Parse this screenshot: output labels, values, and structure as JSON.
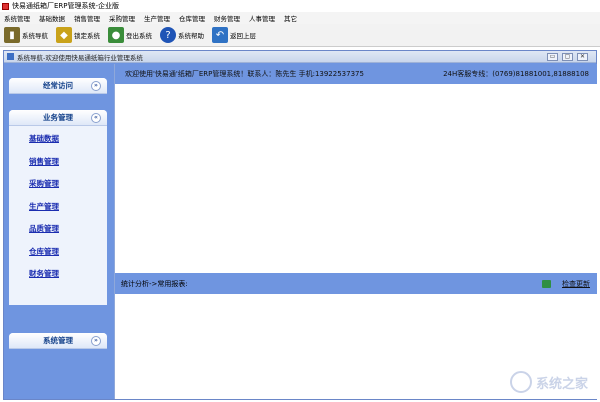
{
  "window": {
    "title": "快易通纸箱厂ERP管理系统-企业版"
  },
  "menu": [
    "系统管理",
    "基础数据",
    "销售管理",
    "采购管理",
    "生产管理",
    "仓库管理",
    "财务管理",
    "人事管理",
    "其它"
  ],
  "toolbar": [
    {
      "label": "系统导航",
      "icon": "book-icon",
      "color": "#7a6a2a"
    },
    {
      "label": "锁定系统",
      "icon": "lock-icon",
      "color": "#c9a21a"
    },
    {
      "label": "登出系统",
      "icon": "users-icon",
      "color": "#3a8d3a"
    },
    {
      "label": "系统帮助",
      "icon": "help-icon",
      "color": "#1f54b6"
    },
    {
      "label": "返回上层",
      "icon": "back-arrow-icon",
      "color": "#2f72c4"
    }
  ],
  "inner_window": {
    "title": "系统导航-欢迎使用快易通纸箱行业管理系统",
    "buttons": [
      "▭",
      "▢",
      "✕"
    ]
  },
  "sidebar": {
    "panels": [
      {
        "title": "经常访问",
        "expanded": false
      },
      {
        "title": "业务管理",
        "expanded": true,
        "items": [
          "基础数据",
          "销售管理",
          "采购管理",
          "生产管理",
          "品质管理",
          "仓库管理",
          "财务管理"
        ]
      },
      {
        "title": "系统管理",
        "expanded": false
      }
    ]
  },
  "welcome": {
    "text": "欢迎使用'快易通'纸箱厂ERP管理系统！联系人：陈先生 手机:13922537375",
    "hotline": "24H客服专线：(0769)81881001,81888108"
  },
  "stats": {
    "label": "统计分析->常用报表:",
    "update_label": "检查更新"
  },
  "watermark": {
    "text": "系统之家"
  }
}
